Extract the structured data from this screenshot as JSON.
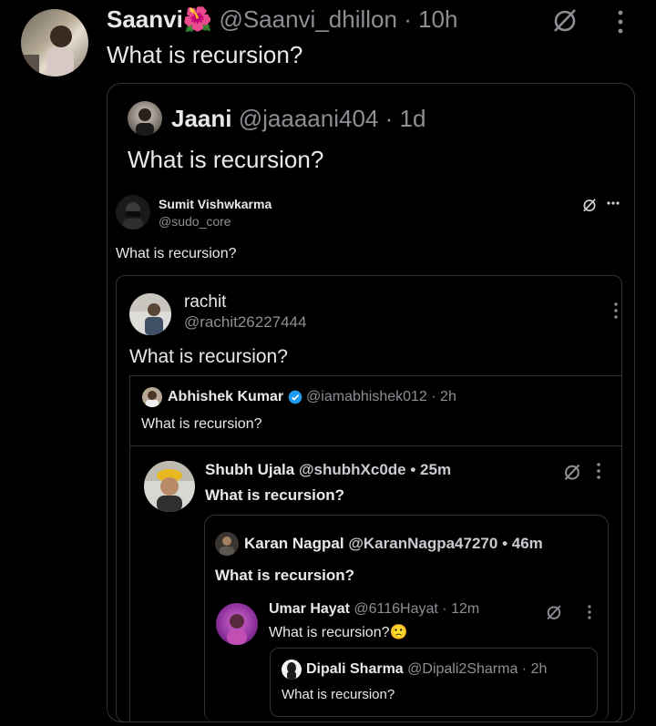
{
  "tweet1": {
    "name": "Saanvi",
    "emoji": "🌺",
    "handle": "@Saanvi_dhillon",
    "time": "· 10h",
    "text": "What is recursion?"
  },
  "tweet2": {
    "name": "Jaani",
    "handle": "@jaaaani404",
    "time": "· 1d",
    "text": "What is recursion?"
  },
  "tweet3": {
    "name": "Sumit Vishwkarma",
    "handle": "@sudo_core",
    "text": "What is recursion?"
  },
  "tweet4": {
    "name": "rachit",
    "handle": "@rachit26227444",
    "text": "What is recursion?"
  },
  "tweet5": {
    "name": "Abhishek Kumar",
    "handle": "@iamabhishek012",
    "time": "· 2h",
    "text": "What is recursion?"
  },
  "tweet6": {
    "name": "Shubh Ujala",
    "handle": "@shubhXc0de",
    "time": "• 25m",
    "text": "What is recursion?"
  },
  "tweet7": {
    "name": "Karan Nagpal",
    "handle": "@KaranNagpa47270",
    "time": "• 46m",
    "text": "What is recursion?"
  },
  "tweet8": {
    "name": "Umar Hayat",
    "handle": "@6116Hayat",
    "time": "· 12m",
    "text": "What is recursion?",
    "emoji": "🙁"
  },
  "tweet9": {
    "name": "Dipali Sharma",
    "handle": "@Dipali2Sharma",
    "time": "· 2h",
    "text": "What is recursion?"
  },
  "icons": {
    "grok": "grok-slash-icon",
    "more": "more-options-icon",
    "verified": "verified-badge-icon"
  },
  "colors": {
    "background": "#000000",
    "text": "#e7e9ea",
    "muted": "#8b8f94",
    "border": "#3a3d41",
    "verified": "#1d9bf0"
  }
}
